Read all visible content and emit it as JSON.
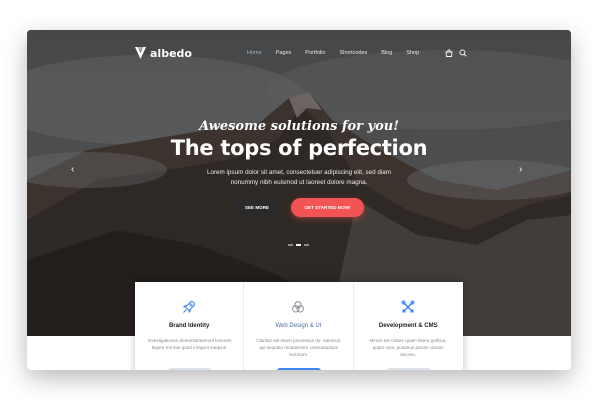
{
  "brand": {
    "name": "albedo"
  },
  "nav": {
    "items": [
      {
        "label": "Home",
        "active": true
      },
      {
        "label": "Pages"
      },
      {
        "label": "Portfolio"
      },
      {
        "label": "Shortcodes"
      },
      {
        "label": "Blog"
      },
      {
        "label": "Shop"
      }
    ],
    "icons": [
      "bag-icon",
      "search-icon"
    ]
  },
  "hero": {
    "script": "Awesome solutions for you!",
    "headline": "The tops of perfection",
    "subtext": "Lorem ipsum dolor sit amet, consectetuer adipiscing elit, sed diam nonummy nibh euismod ut laoreet dolore magna.",
    "btn_primary": "SEE MORE",
    "btn_accent": "GET STARTED NOW!",
    "slides_total": 3,
    "slide_active": 2,
    "accent_color": "#f25454"
  },
  "features": [
    {
      "icon": "rocket-icon",
      "title": "Brand Identity",
      "text": "Investigationes demonstraverunt lectores legere me lius quod ii legunt saepius."
    },
    {
      "icon": "circles-icon",
      "title": "Web Design & UI",
      "text": "Claritas est etiam processus dy- namicus, qui sequitur mutationem consuetudium lectorum."
    },
    {
      "icon": "tools-icon",
      "title": "Development & CMS",
      "text": "Mirum est notare quam littera gothica, quam nunc putamus parum claram decima."
    }
  ]
}
